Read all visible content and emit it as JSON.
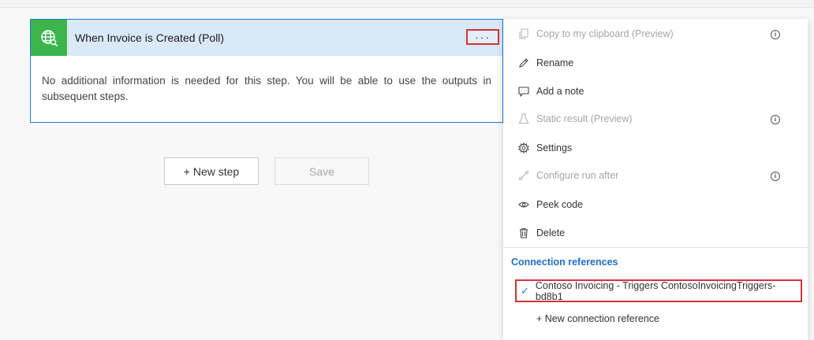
{
  "step": {
    "title": "When Invoice is Created (Poll)",
    "more_label": "···",
    "body": "No additional information is needed for this step. You will be able to use the outputs in subsequent steps.",
    "icon": "globe-search-icon",
    "icon_bg": "#3bb54a",
    "header_bg": "#d9e9f8",
    "border_color": "#1f7ad3"
  },
  "actions": {
    "new_step": "+ New step",
    "save": "Save"
  },
  "menu": {
    "items": [
      {
        "label": "Copy to my clipboard (Preview)",
        "icon": "copy-icon",
        "disabled": true,
        "info": true
      },
      {
        "label": "Rename",
        "icon": "pencil-icon",
        "disabled": false,
        "info": false
      },
      {
        "label": "Add a note",
        "icon": "note-icon",
        "disabled": false,
        "info": false
      },
      {
        "label": "Static result (Preview)",
        "icon": "flask-icon",
        "disabled": true,
        "info": true
      },
      {
        "label": "Settings",
        "icon": "gear-icon",
        "disabled": false,
        "info": false
      },
      {
        "label": "Configure run after",
        "icon": "run-after-icon",
        "disabled": true,
        "info": true
      },
      {
        "label": "Peek code",
        "icon": "eye-icon",
        "disabled": false,
        "info": false
      },
      {
        "label": "Delete",
        "icon": "trash-icon",
        "disabled": false,
        "info": false
      }
    ],
    "connection_section_title": "Connection references",
    "connection_reference": "Contoso Invoicing - Triggers ContosoInvoicingTriggers-bd8b1",
    "new_connection": "+ New connection reference",
    "info_glyph": "i",
    "check_glyph": "✓",
    "highlight_color": "#d13438",
    "accent_color": "#1f6fc5"
  }
}
